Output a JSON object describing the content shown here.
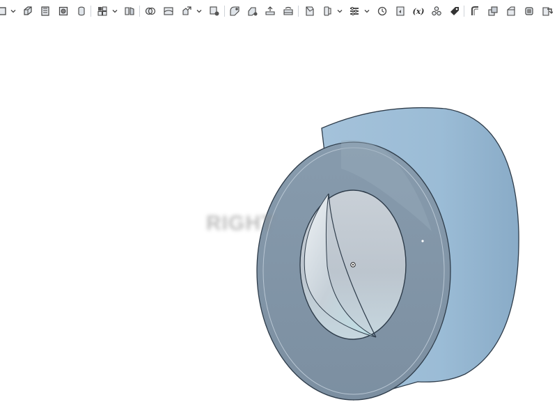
{
  "toolbar": {
    "variables_label": "(x)",
    "tools": [
      "sketch-icon",
      "extrude-icon",
      "revolve-icon",
      "sweep-icon",
      "loft-icon",
      "pattern-icon",
      "mirror-icon",
      "boolean-icon",
      "split-icon",
      "transform-icon",
      "fillet-icon",
      "chamfer-icon",
      "draft-icon",
      "shell-icon",
      "rib-icon",
      "plane-icon",
      "mate-connector-icon",
      "measure-icon",
      "section-icon",
      "variables-icon",
      "assembly-icon",
      "appearance-icon",
      "surface-icon",
      "thicken-icon",
      "enclose-icon",
      "offset-surface-icon",
      "replace-face-icon"
    ]
  },
  "viewport": {
    "view_face_label": "RIGHT",
    "part_color": "#9bbcd6",
    "part_edge_color": "#2e3c4a",
    "background": "#ffffff"
  }
}
